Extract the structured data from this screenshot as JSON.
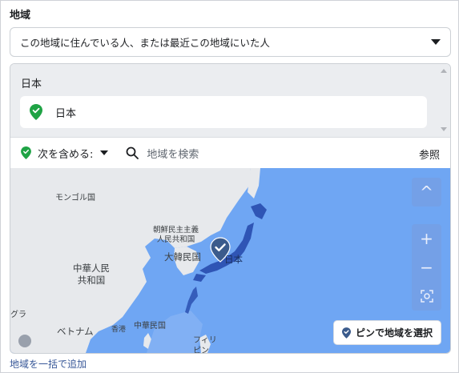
{
  "section": {
    "title": "地域"
  },
  "location_type": {
    "selected": "この地域に住んでいる人、または最近この地域にいた人"
  },
  "selected_locations": {
    "heading": "日本",
    "items": [
      {
        "label": "日本"
      }
    ]
  },
  "filter": {
    "include_label": "次を含める:",
    "search_placeholder": "地域を検索",
    "browse_label": "参照"
  },
  "map": {
    "labels": {
      "mongolia": "モンゴル国",
      "north_korea": "朝鮮民主主義\n人民共和国",
      "south_korea": "大韓民国",
      "japan": "日本",
      "china": "中華人民\n共和国",
      "vietnam": "ベトナム",
      "hongkong": "香港",
      "taiwan": "中華民国",
      "philippines": "フィリ\nピン",
      "edge": "グラ"
    },
    "controls": {
      "up": "^",
      "zoom_in": "+",
      "zoom_out": "−"
    },
    "pin_button_label": "ピンで地域を選択"
  },
  "footer": {
    "bulk_add_link": "地域を一括で追加"
  },
  "colors": {
    "accent_green": "#1fa345",
    "link": "#385898",
    "map_water": "#6fa6f3",
    "selected_region": "#2f55b5"
  }
}
